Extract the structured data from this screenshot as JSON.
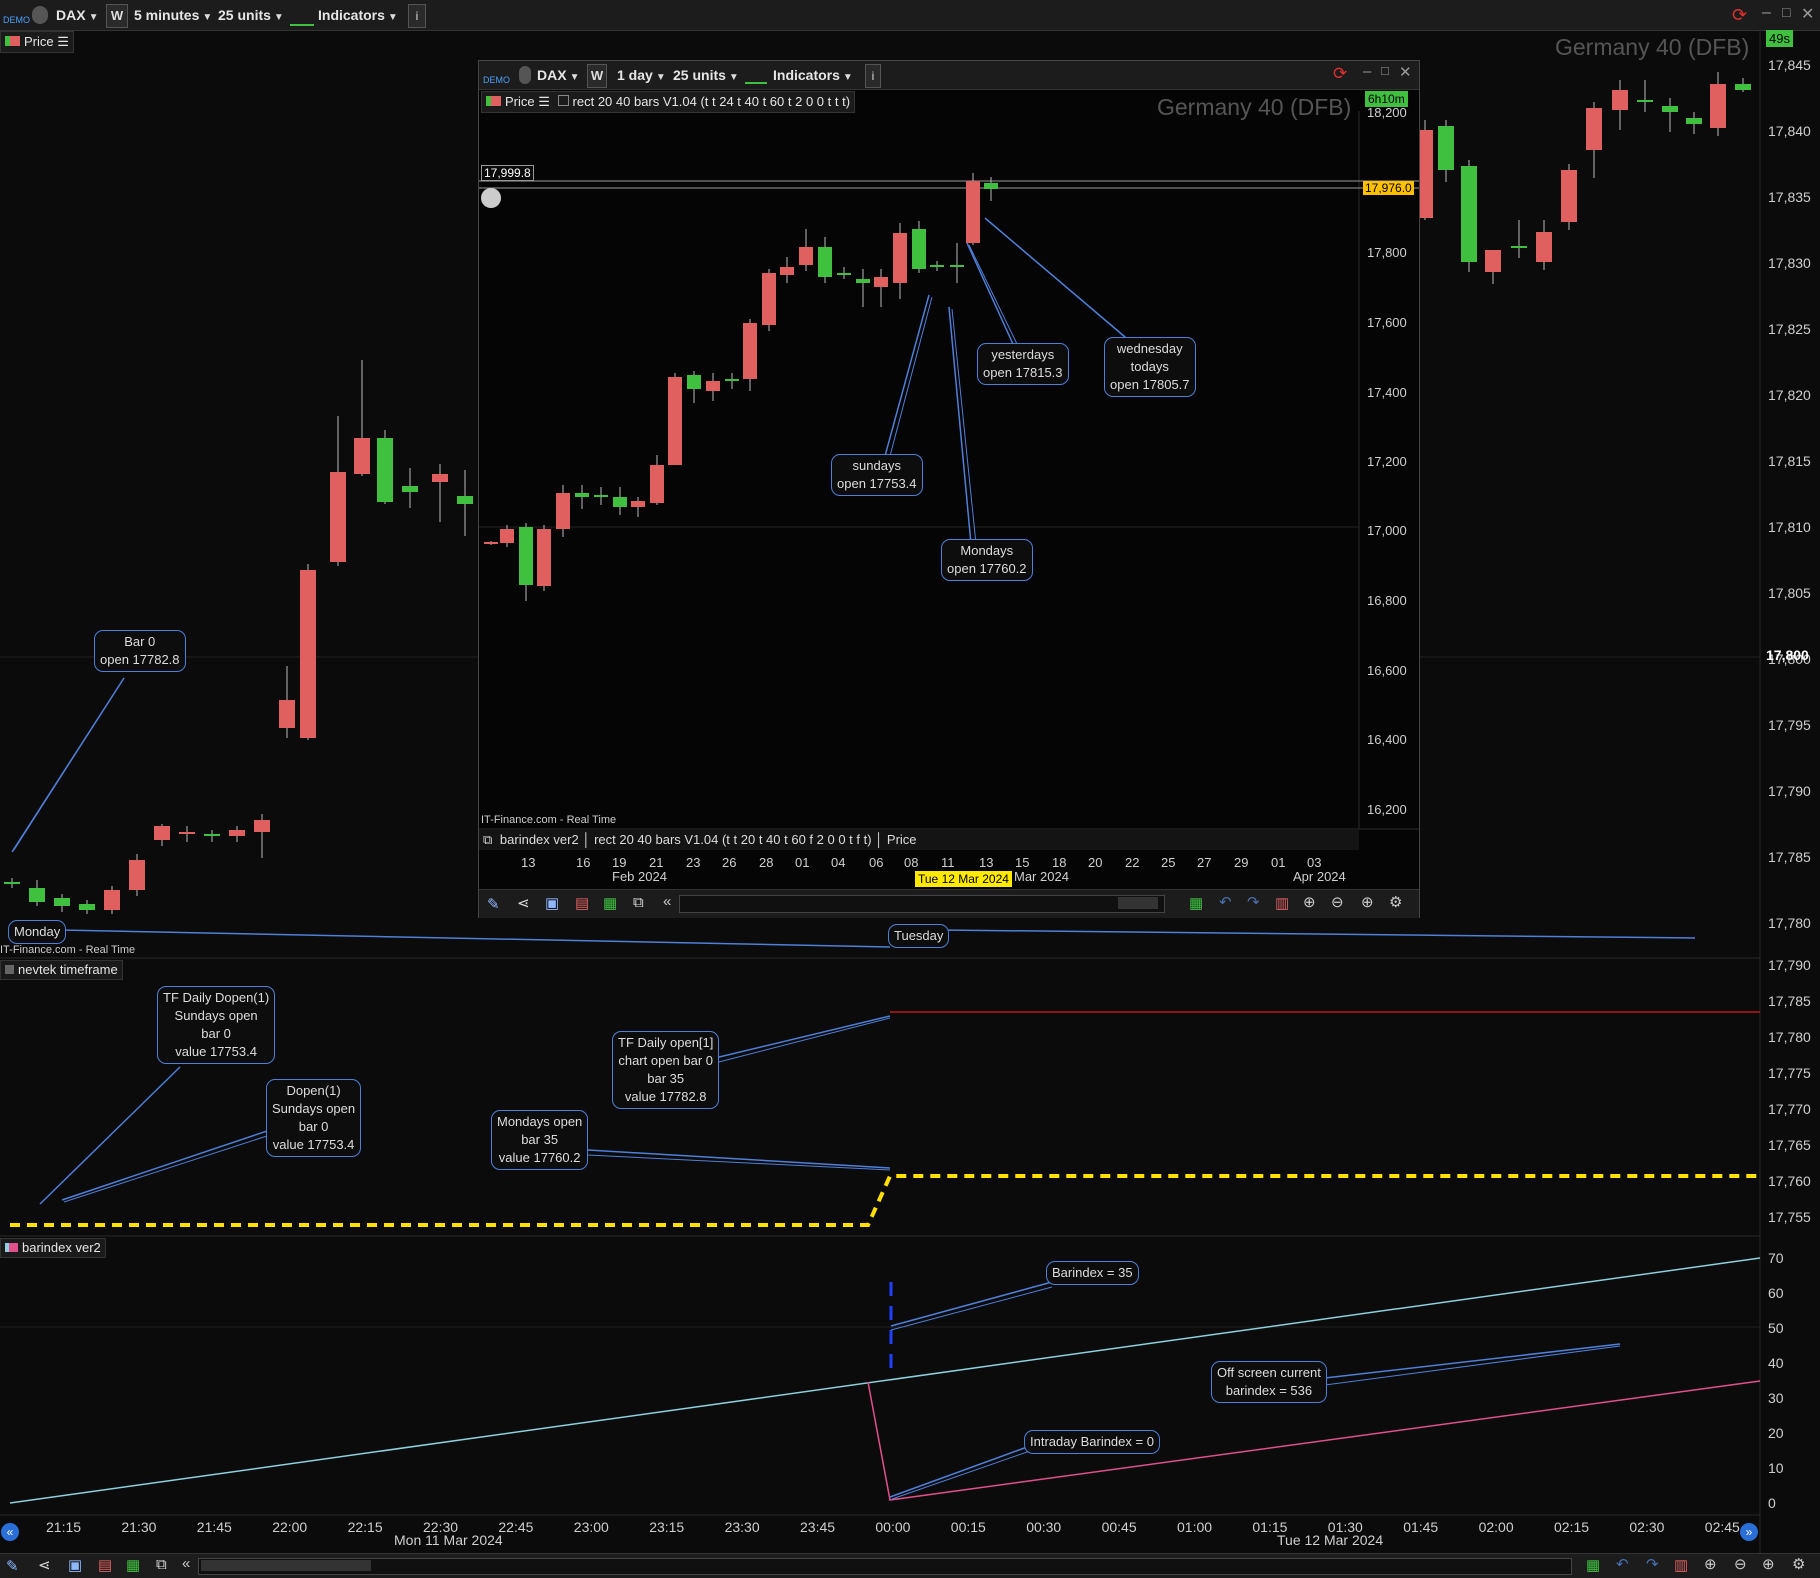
{
  "main_toolbar": {
    "demo_label": "DEMO",
    "instrument": "DAX",
    "w_label": "W",
    "timeframe": "5 minutes",
    "units": "25 units",
    "indicators": "Indicators",
    "info": "i"
  },
  "price_tab": "Price",
  "watermark": "Germany 40 (DFB)",
  "timer": "49s",
  "right_axis_main": [
    "17,845",
    "17,840",
    "17,835",
    "17,830",
    "17,825",
    "17,820",
    "17,815",
    "17,810",
    "17,805",
    "17,800",
    "17,795",
    "17,790",
    "17,785",
    "17,780"
  ],
  "right_axis_osc": [
    "17,790",
    "17,785",
    "17,780",
    "17,775",
    "17,770",
    "17,765",
    "17,760",
    "17,755"
  ],
  "right_axis_bar": [
    "70",
    "60",
    "50",
    "40",
    "30",
    "20",
    "10",
    "0"
  ],
  "time_axis": [
    "21:15",
    "21:30",
    "21:45",
    "22:00",
    "22:15",
    "22:30",
    "22:45",
    "23:00",
    "23:15",
    "23:30",
    "23:45",
    "00:00",
    "00:15",
    "00:30",
    "00:45",
    "01:00",
    "01:15",
    "01:30",
    "01:45",
    "02:00",
    "02:15",
    "02:30",
    "02:45"
  ],
  "date_labels": {
    "mon": "Mon 11 Mar 2024",
    "tue": "Tue 12 Mar 2024"
  },
  "source_main": "IT-Finance.com - Real Time",
  "panel_nevtek": "nevtek timeframe",
  "panel_barindex": "barindex ver2",
  "callouts_main": {
    "bar0": [
      "Bar 0",
      "open 17782.8"
    ],
    "monday": "Monday",
    "tuesday": "Tuesday"
  },
  "callouts_osc": {
    "tf_daily_dopen": [
      "TF Daily Dopen(1)",
      "Sundays open",
      "bar 0",
      "value 17753.4"
    ],
    "dopen": [
      "Dopen(1)",
      "Sundays open",
      "bar 0",
      "value 17753.4"
    ],
    "mondays_open": [
      "Mondays open",
      "bar 35",
      "value 17760.2"
    ],
    "tf_daily_open": [
      "TF Daily open[1]",
      "chart open bar 0",
      "bar 35",
      "value 17782.8"
    ]
  },
  "callouts_bar": {
    "barindex35": "Barindex = 35",
    "offscreen": [
      "Off screen current",
      "barindex = 536"
    ],
    "intraday": "Intraday Barindex = 0"
  },
  "inner": {
    "instrument": "DAX",
    "w_label": "W",
    "timeframe": "1 day",
    "units": "25 units",
    "indicators": "Indicators",
    "info": "i",
    "price_tab": "Price",
    "indicator_line": "rect 20 40 bars V1.04 (t t 24 t 40 t 60 t 2 0 0 t t t)",
    "watermark": "Germany 40 (DFB)",
    "timer": "6h10m",
    "level_label": "17,999.8",
    "current_price": "17,976.0",
    "right_axis": [
      "18,200",
      "17,800",
      "17,600",
      "17,400",
      "17,200",
      "17,000",
      "16,800",
      "16,600",
      "16,400",
      "16,200"
    ],
    "source": "IT-Finance.com - Real Time",
    "bottom_tabs": [
      "barindex ver2",
      "rect 20 40 bars V1.04 (t t 20 t 40 t 60 f 2 0 0 t f t)",
      "Price"
    ],
    "x_axis": [
      "13",
      "16",
      "19",
      "21",
      "23",
      "26",
      "28",
      "01",
      "04",
      "06",
      "08",
      "11",
      "13",
      "15",
      "18",
      "20",
      "22",
      "25",
      "27",
      "29",
      "01",
      "03"
    ],
    "months": [
      "Feb 2024",
      "Mar 2024",
      "Apr 2024"
    ],
    "selected_date": "Tue 12 Mar 2024",
    "callouts": {
      "sundays": [
        "sundays",
        "open 17753.4"
      ],
      "mondays": [
        "Mondays",
        "open 17760.2"
      ],
      "yesterdays": [
        "yesterdays",
        "open 17815.3"
      ],
      "wednesday": [
        "wednesday",
        "todays",
        "open 17805.7"
      ]
    }
  },
  "colors": {
    "bull": "#3fc03f",
    "bear": "#e06060",
    "line_blue": "#4f7fd8",
    "dash_yellow": "#ffe000",
    "red_line": "#c01818",
    "cyan": "#8fd0e0",
    "pink": "#e0508a"
  }
}
